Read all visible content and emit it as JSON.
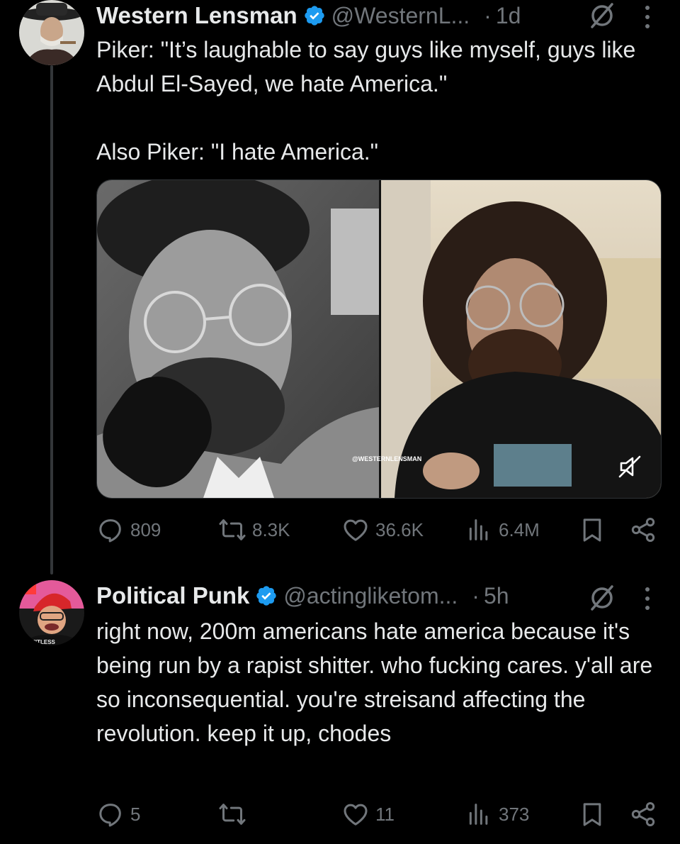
{
  "thread": {
    "tweets": [
      {
        "display_name": "Western Lensman",
        "handle": "@WesternL...",
        "separator": "·",
        "time": "1d",
        "text": "Piker: \"It’s laughable to say guys like myself, guys like Abdul El-Sayed, we hate America.\"\n\nAlso Piker: \"I hate America.\"",
        "media": {
          "watermark": "@WESTERNLENSMAN",
          "muted_icon": "speaker-muted-icon"
        },
        "stats": {
          "replies": "809",
          "reposts": "8.3K",
          "likes": "36.6K",
          "views": "6.4M"
        }
      },
      {
        "display_name": "Political Punk",
        "handle": "@actingliketom...",
        "separator": "·",
        "time": "5h",
        "text": "right now, 200m americans hate america because it's being run by a rapist shitter. who fucking cares. y'all are so inconsequential. you're streisand affecting the revolution. keep it up, chodes",
        "stats": {
          "replies": "5",
          "reposts": "",
          "likes": "11",
          "views": "373"
        }
      }
    ]
  },
  "colors": {
    "background": "#000000",
    "text": "#e7e9ea",
    "muted": "#71767b",
    "verified": "#1d9bf0"
  },
  "icons": [
    "verified-badge-icon",
    "grok-icon",
    "more-icon",
    "reply-icon",
    "repost-icon",
    "like-icon",
    "views-icon",
    "bookmark-icon",
    "share-icon"
  ]
}
